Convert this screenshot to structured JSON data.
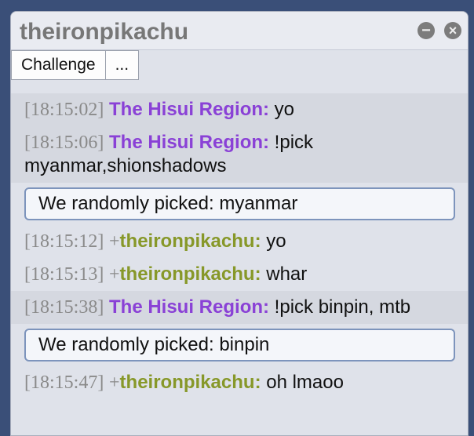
{
  "window": {
    "title": "theironpikachu",
    "minimize_glyph": "−",
    "close_glyph": "×"
  },
  "toolbar": {
    "challenge_label": "Challenge",
    "more_label": "..."
  },
  "messages": [
    {
      "time": "[18:15:02]",
      "rank": "",
      "user": "The Hisui Region:",
      "text": "yo"
    },
    {
      "time": "[18:15:06]",
      "rank": "",
      "user": "The Hisui Region:",
      "text": "!pick myanmar,shionshadows"
    },
    {
      "notice": "We randomly picked:  myanmar"
    },
    {
      "time": "[18:15:12]",
      "rank": "+",
      "user": "theironpikachu:",
      "text": "yo"
    },
    {
      "time": "[18:15:13]",
      "rank": "+",
      "user": "theironpikachu:",
      "text": "whar"
    },
    {
      "time": "[18:15:38]",
      "rank": "",
      "user": "The Hisui Region:",
      "text": "!pick binpin, mtb"
    },
    {
      "notice": "We randomly picked:  binpin"
    },
    {
      "time": "[18:15:47]",
      "rank": "+",
      "user": "theironpikachu:",
      "text": "oh lmaoo"
    }
  ],
  "colors": {
    "hisui_user": "#8a41d6",
    "pikachu_user": "#879829",
    "notice_border": "#7d94bc"
  }
}
